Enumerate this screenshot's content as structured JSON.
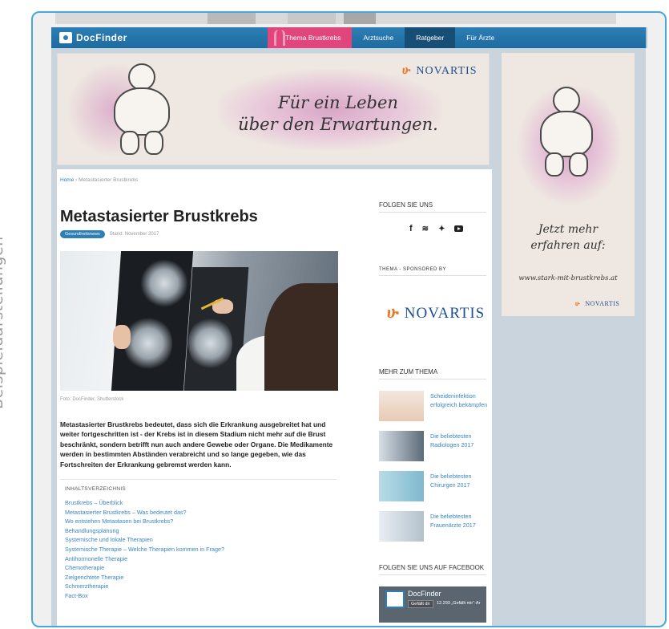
{
  "caption": "Beispieldarstellungen",
  "navbar": {
    "logo": "DocFinder",
    "items": [
      {
        "label": "Thema Brustkrebs",
        "style": "pink"
      },
      {
        "label": "Arztsuche",
        "style": "plain"
      },
      {
        "label": "Ratgeber",
        "style": "dark"
      },
      {
        "label": "Für Ärzte",
        "style": "plain"
      }
    ]
  },
  "banner": {
    "brand": "NOVARTIS",
    "tagline_line1": "Für ein Leben",
    "tagline_line2": "über den Erwartungen."
  },
  "side_ad": {
    "cta_line1": "Jetzt mehr",
    "cta_line2": "erfahren auf:",
    "url": "www.stark-mit-brustkrebs.at",
    "brand": "NOVARTIS"
  },
  "breadcrumb": {
    "home": "Home",
    "separator": "›",
    "current": "Metastasierter Brustkrebs"
  },
  "article": {
    "title": "Metastasierter Brustkrebs",
    "tag": "Gesundheitsnews",
    "date": "Stand: November 2017",
    "photo_credit": "Foto: DocFinder, Shutterstock",
    "lead": "Metastasierter Brustkrebs bedeutet, dass sich die Erkrankung ausgebreitet hat und weiter fortgeschritten ist - der Krebs ist in diesem Stadium nicht mehr auf die Brust beschränkt, sondern betrifft nun auch andere Gewebe oder Organe. Die Medikamente werden in bestimmten Abständen verabreicht und so lange gegeben, wie das Fortschreiten der Erkrankung gebremst werden kann."
  },
  "toc": {
    "heading": "INHALTSVERZEICHNIS",
    "items": [
      "Brustkrebs – Überblick",
      "Metastasierter Brustkrebs – Was bedeutet das?",
      "Wo entstehen Metastasen bei Brustkrebs?",
      "Behandlungsplanung",
      "Systemische und lokale Therapien",
      "Systemische Therapie – Welche Therapien kommen in Frage?",
      "Antihormonelle Therapie",
      "Chemotherapie",
      "Zielgerichtete Therapie",
      "Schmerztherapie",
      "Fact-Box"
    ]
  },
  "sidebar": {
    "follow_heading": "FOLGEN SIE UNS",
    "social_icons": [
      "facebook-icon",
      "rss-icon",
      "twitter-icon",
      "youtube-icon"
    ],
    "sponsor_label": "THEMA - SPONSORED BY",
    "sponsor_brand": "NOVARTIS",
    "more_heading": "MEHR ZUM THEMA",
    "related": [
      {
        "title": "Scheideninfektion erfolgreich bekämpfen"
      },
      {
        "title": "Die beliebtesten Radiologen 2017"
      },
      {
        "title": "Die beliebtesten Chirurgen 2017"
      },
      {
        "title": "Die beliebtesten Frauenärzte 2017"
      }
    ],
    "facebook_heading": "FOLGEN SIE UNS AUF FACEBOOK",
    "facebook": {
      "page_name": "DocFinder",
      "like_button": "Gefällt dir",
      "likes_text": "12.293 „Gefällt mir“-Ar"
    }
  },
  "colors": {
    "frame": "#49a8d8",
    "nav": "#2d7fb5",
    "accent_pink": "#e0457c",
    "link": "#3a86c4",
    "brand_blue": "#1e4f91"
  }
}
